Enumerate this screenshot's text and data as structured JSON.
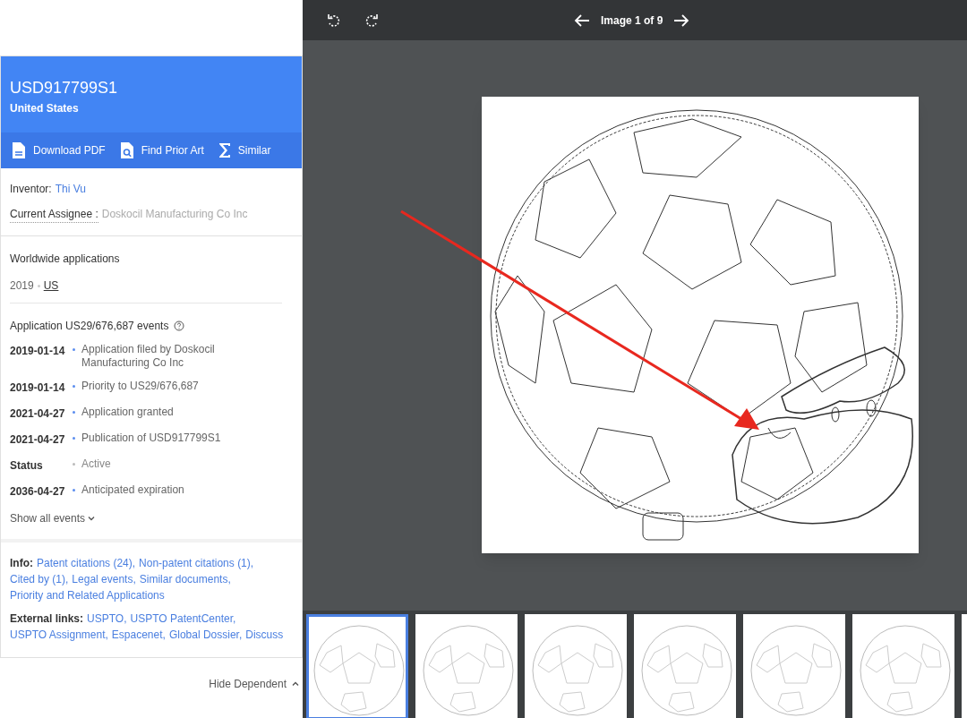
{
  "header": {
    "number": "USD917799S1",
    "country": "United States"
  },
  "actions": [
    {
      "kind": "pdf",
      "label": "Download PDF"
    },
    {
      "kind": "prior-art",
      "label": "Find Prior Art"
    },
    {
      "kind": "similar",
      "label": "Similar"
    }
  ],
  "inventor": {
    "label": "Inventor:",
    "value": "Thi Vu"
  },
  "assignee": {
    "label": "Current Assignee :",
    "value": "Doskocil Manufacturing Co Inc"
  },
  "worldwide": {
    "title": "Worldwide applications",
    "year": "2019",
    "country": "US"
  },
  "events": {
    "title": "Application US29/676,687 events",
    "rows": [
      {
        "kind": "event",
        "date": "2019-01-14",
        "text": "Application filed by Doskocil Manufacturing Co Inc"
      },
      {
        "kind": "event",
        "date": "2019-01-14",
        "text": "Priority to US29/676,687"
      },
      {
        "kind": "event",
        "date": "2021-04-27",
        "text": "Application granted"
      },
      {
        "kind": "event",
        "date": "2021-04-27",
        "text": "Publication of USD917799S1"
      },
      {
        "kind": "status",
        "date": "Status",
        "text": "Active"
      },
      {
        "kind": "event",
        "date": "2036-04-27",
        "text": "Anticipated expiration"
      }
    ],
    "show_all": "Show all events"
  },
  "info": {
    "label": "Info:",
    "links": [
      "Patent citations (24),",
      "Non-patent citations (1),",
      "Cited by (1),",
      "Legal events,",
      "Similar documents,",
      "Priority and Related Applications"
    ]
  },
  "external": {
    "label": "External links:",
    "links": [
      "USPTO,",
      "USPTO PatentCenter,",
      "USPTO Assignment,",
      "Espacenet,",
      "Global Dossier,",
      "Discuss"
    ]
  },
  "hide_dependent": "Hide Dependent",
  "viewer": {
    "counter": "Image 1 of 9",
    "thumbnails": [
      {
        "selected": true
      },
      {
        "selected": false
      },
      {
        "selected": false
      },
      {
        "selected": false
      },
      {
        "selected": false
      },
      {
        "selected": false
      },
      {
        "selected": false
      }
    ]
  }
}
